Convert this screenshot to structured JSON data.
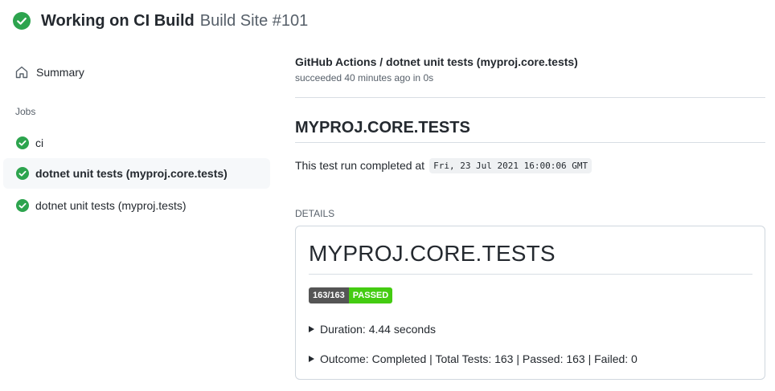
{
  "header": {
    "title": "Working on CI Build",
    "subtitle": "Build Site #101",
    "status_icon": "check-circle-icon"
  },
  "sidebar": {
    "summary_label": "Summary",
    "summary_icon": "home-icon",
    "jobs_heading": "Jobs",
    "jobs": [
      {
        "label": "ci",
        "status": "success"
      },
      {
        "label": "dotnet unit tests (myproj.core.tests)",
        "status": "success",
        "selected": true
      },
      {
        "label": "dotnet unit tests (myproj.tests)",
        "status": "success"
      }
    ]
  },
  "main": {
    "run_title": "GitHub Actions / dotnet unit tests (myproj.core.tests)",
    "run_meta": "succeeded 40 minutes ago in 0s",
    "heading": "MYPROJ.CORE.TESTS",
    "completed_prefix": "This test run completed at",
    "completed_time": "Fri, 23 Jul 2021 16:00:06 GMT",
    "details_label": "DETAILS",
    "card": {
      "title": "MYPROJ.CORE.TESTS",
      "badge_left": "163/163",
      "badge_right": "PASSED",
      "duration": "Duration: 4.44 seconds",
      "outcome": "Outcome: Completed | Total Tests: 163 | Passed: 163 | Failed: 0"
    }
  },
  "colors": {
    "success_green": "#2da44e",
    "badge_gray": "#555555",
    "badge_green": "#44cc11",
    "selected_bg": "#f6f8fa"
  }
}
